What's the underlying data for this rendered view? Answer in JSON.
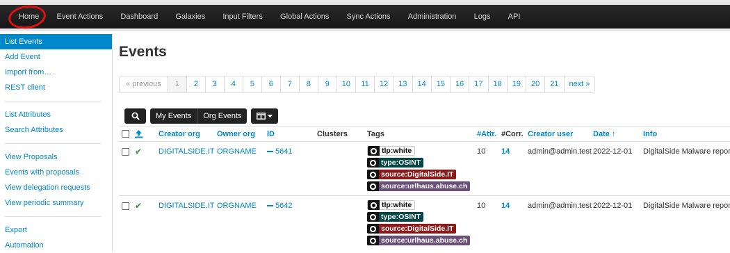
{
  "nav": {
    "items": [
      "Home",
      "Event Actions",
      "Dashboard",
      "Galaxies",
      "Input Filters",
      "Global Actions",
      "Sync Actions",
      "Administration",
      "Logs",
      "API"
    ],
    "highlight_color": "#e01010"
  },
  "sidebar": {
    "groups": [
      [
        "List Events",
        "Add Event",
        "Import from…",
        "REST client"
      ],
      [
        "List Attributes",
        "Search Attributes"
      ],
      [
        "View Proposals",
        "Events with proposals",
        "View delegation requests",
        "View periodic summary"
      ],
      [
        "Export",
        "Automation"
      ]
    ],
    "active": "List Events"
  },
  "page": {
    "title": "Events"
  },
  "pagination": {
    "previous": "« previous",
    "pages": [
      "1",
      "2",
      "3",
      "4",
      "5",
      "6",
      "7",
      "8",
      "9",
      "10",
      "11",
      "12",
      "13",
      "14",
      "15",
      "16",
      "17",
      "18",
      "19",
      "20",
      "21"
    ],
    "current": "1",
    "next": "next »"
  },
  "toolbar": {
    "my_events": "My Events",
    "org_events": "Org Events",
    "search_icon": "search-icon",
    "columns_icon": "columns-icon"
  },
  "table": {
    "headers": {
      "creator_org": "Creator org",
      "owner_org": "Owner org",
      "id": "ID",
      "clusters": "Clusters",
      "tags": "Tags",
      "attr": "#Attr.",
      "corr": "#Corr.",
      "creator_user": "Creator user",
      "date": "Date ↑",
      "info": "Info"
    },
    "rows": [
      {
        "creator_org": "DIGITALSIDE.IT",
        "owner_org": "ORGNAME",
        "id": "5641",
        "tags": [
          {
            "label": "tlp:white",
            "bg": "#ffffff",
            "fg": "#000000"
          },
          {
            "label": "type:OSINT",
            "bg": "#004646",
            "fg": "#ffffff"
          },
          {
            "label": "source:DigitalSide.IT",
            "bg": "#8a1a1a",
            "fg": "#ffffff"
          },
          {
            "label": "source:urlhaus.abuse.ch",
            "bg": "#6b4f78",
            "fg": "#ffffff"
          }
        ],
        "attr": "10",
        "corr": "14",
        "creator_user": "admin@admin.test",
        "date": "2022-12-01",
        "info": "DigitalSide Malware report:"
      },
      {
        "creator_org": "DIGITALSIDE.IT",
        "owner_org": "ORGNAME",
        "id": "5642",
        "tags": [
          {
            "label": "tlp:white",
            "bg": "#ffffff",
            "fg": "#000000"
          },
          {
            "label": "type:OSINT",
            "bg": "#004646",
            "fg": "#ffffff"
          },
          {
            "label": "source:DigitalSide.IT",
            "bg": "#8a1a1a",
            "fg": "#ffffff"
          },
          {
            "label": "source:urlhaus.abuse.ch",
            "bg": "#6b4f78",
            "fg": "#ffffff"
          }
        ],
        "attr": "10",
        "corr": "14",
        "creator_user": "admin@admin.test",
        "date": "2022-12-01",
        "info": "DigitalSide Malware report:"
      }
    ]
  }
}
